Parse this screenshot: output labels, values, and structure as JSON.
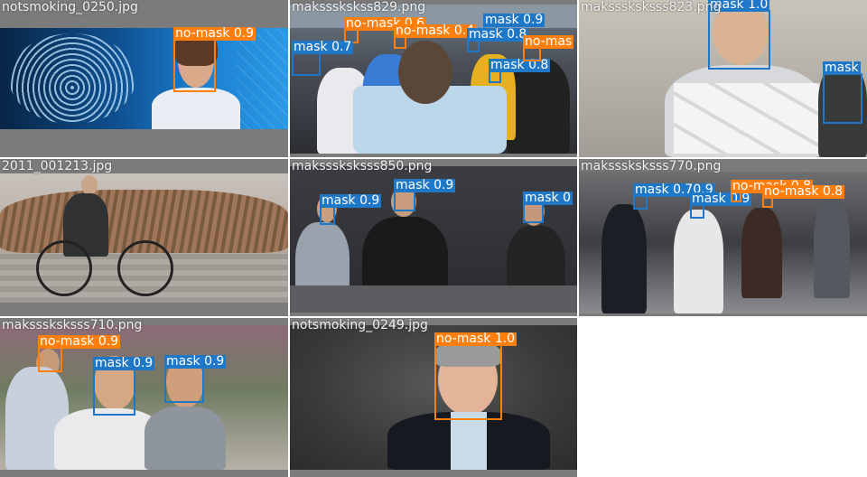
{
  "tiles": [
    {
      "filename": "notsmoking_0250.jpg",
      "detections": [
        {
          "label": "no-mask",
          "score": "0.9"
        }
      ]
    },
    {
      "filename": "makssskskss829.png",
      "detections": [
        {
          "label": "no-mask",
          "score": "0.6"
        },
        {
          "label": "no-mask",
          "score": "0.4"
        },
        {
          "label": "mask",
          "score": "0.9"
        },
        {
          "label": "mask",
          "score": "0.8"
        },
        {
          "label": "mask",
          "score": "0.8"
        },
        {
          "label": "mask",
          "score": "0.7"
        },
        {
          "label": "no-mas",
          "score": ""
        }
      ]
    },
    {
      "filename": "maksssksksss823.png",
      "detections": [
        {
          "label": "mask",
          "score": "1.0"
        },
        {
          "label": "mask",
          "score": ""
        }
      ]
    },
    {
      "filename": "2011_001213.jpg",
      "detections": []
    },
    {
      "filename": "maksssksksss850.png",
      "detections": [
        {
          "label": "mask",
          "score": "0.9"
        },
        {
          "label": "mask",
          "score": "0.9"
        },
        {
          "label": "mask",
          "score": "0"
        }
      ]
    },
    {
      "filename": "maksssksksss770.png",
      "detections": [
        {
          "label": "mask",
          "score": "0.70.9"
        },
        {
          "label": "mask",
          "score": "0.9"
        },
        {
          "label": "no-mask",
          "score": "0.8"
        },
        {
          "label": "no-mask",
          "score": "0.8"
        }
      ]
    },
    {
      "filename": "maksssksksss710.png",
      "detections": [
        {
          "label": "no-mask",
          "score": "0.9"
        },
        {
          "label": "mask",
          "score": "0.9"
        },
        {
          "label": "mask",
          "score": "0.9"
        }
      ]
    },
    {
      "filename": "notsmoking_0249.jpg",
      "detections": [
        {
          "label": "no-mask",
          "score": "1.0"
        }
      ]
    }
  ],
  "colors": {
    "mask": "#1f77c8",
    "no_mask": "#ff7f0e",
    "tile_bg": "#7b7b7b"
  }
}
